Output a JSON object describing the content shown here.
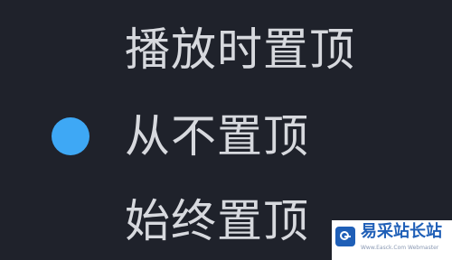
{
  "menu": {
    "items": [
      {
        "label": "播放时置顶",
        "selected": false
      },
      {
        "label": "从不置顶",
        "selected": true
      },
      {
        "label": "始终置顶",
        "selected": false
      }
    ],
    "selected_color": "#3ea8f5"
  },
  "watermark": {
    "title": "易采站长站",
    "url": "Www.Easck.Com  Webmaster"
  }
}
